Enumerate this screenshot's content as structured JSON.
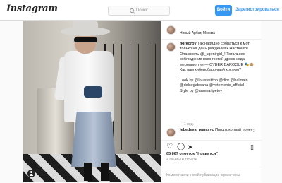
{
  "topbar": {
    "logo": "Instagram",
    "search_placeholder": "Поиск",
    "login_label": "Войти",
    "signup_label": "Зарегистрироваться",
    "accent": "#3897f0"
  },
  "post": {
    "location": "Новый Арбат, Москва",
    "caption": {
      "username": "fkirkorov",
      "text": " Так нарядно собраться к мот только на день рождения к Настюшки Опасность @_ugenirgirl_! Тотальное соблюдение всех гостей дресс-кода мероприятия — CYBER BAROQUE 🎭🙊\nКак вам киберсбарочный костюм?\n\nLook by @louisvuitton @dior @balmain @dolcegabbana @vetements_official\nStyle by @arsenaripetev",
      "time": "1 нед."
    },
    "comment": {
      "username": "lebedeva_panasyc",
      "text": "Придуркотвый понеу"
    },
    "actions": {
      "like_icon": "heart-outline-icon",
      "comment_icon": "comment-icon",
      "share_icon": "share-icon",
      "save_icon": "bookmark-icon"
    },
    "likes": "65 867 отметок \"Нравится\"",
    "date": "3 НЕДЕЛИ НАЗАД",
    "comments_closed": "Комментарии к этой публикации ограничены."
  }
}
